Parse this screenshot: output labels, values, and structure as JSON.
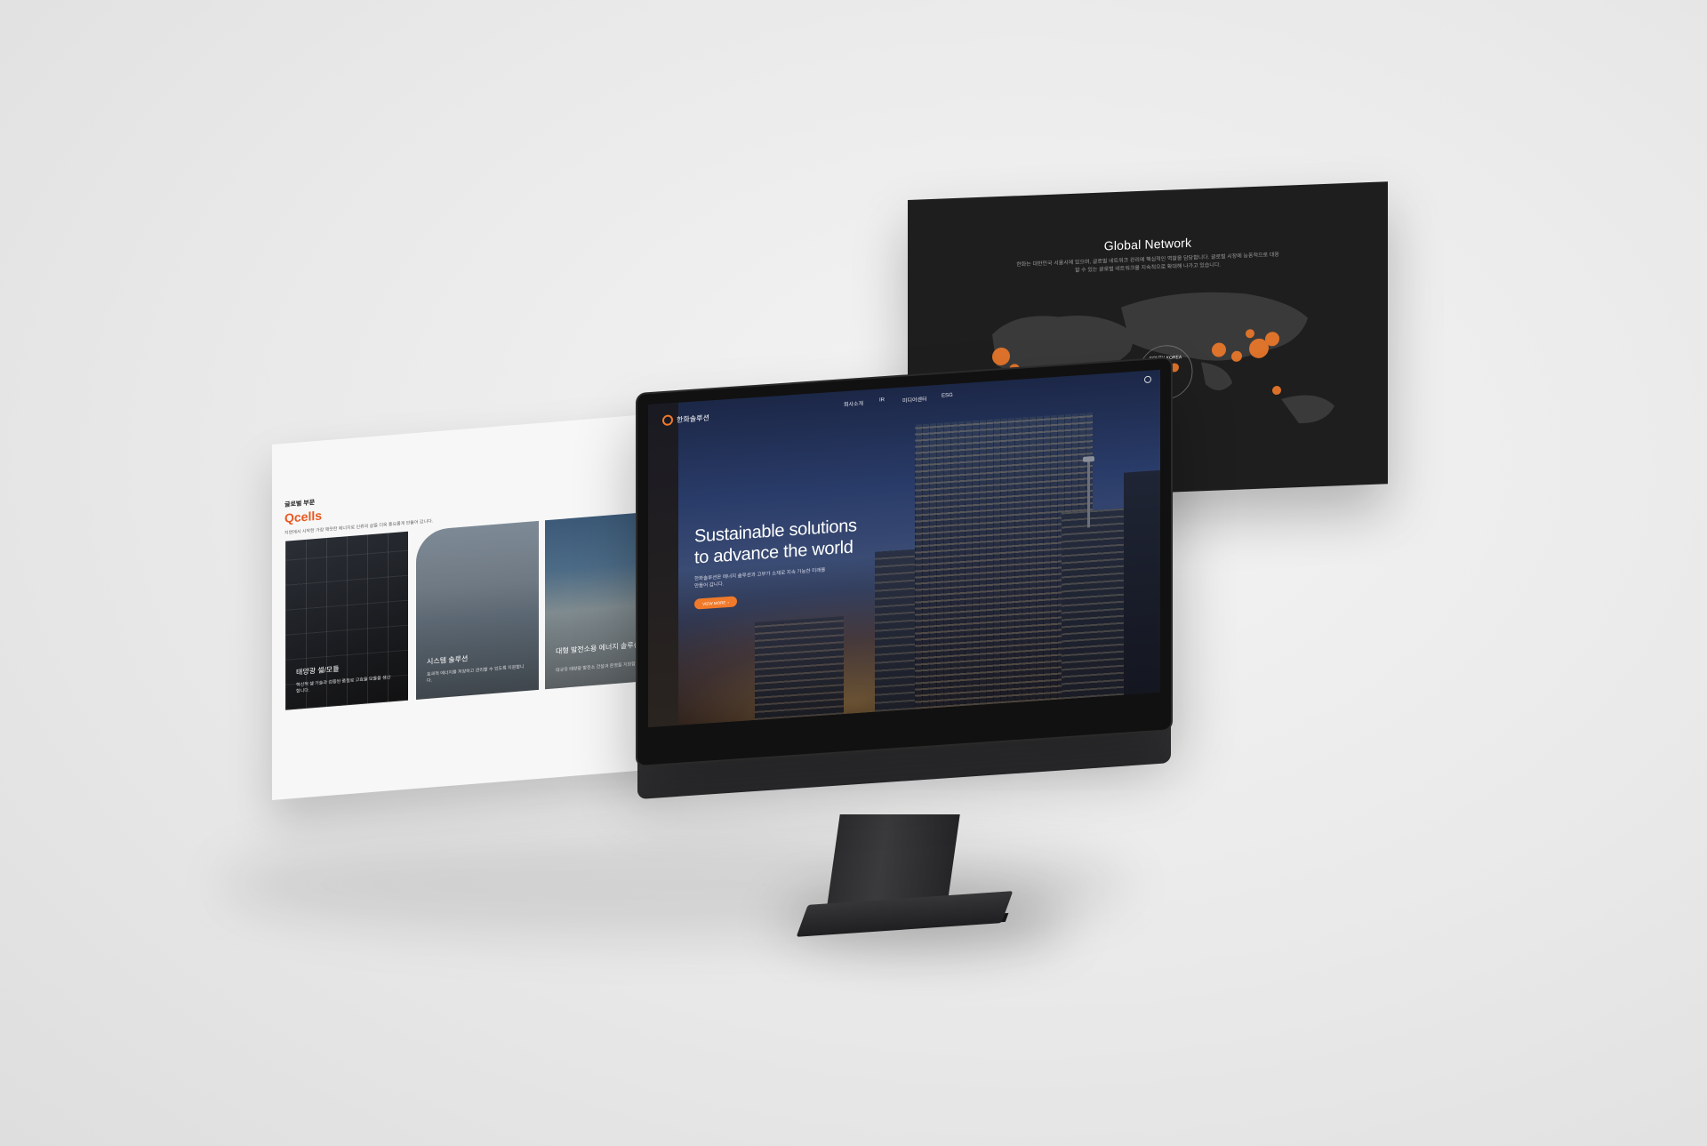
{
  "network_panel": {
    "title": "Global Network",
    "description": "한화는 대한민국 서울시에 있으며, 글로벌 네트워크 관리에 핵심적인 역할을 담당합니다. 글로벌 시장에 능동적으로 대응할 수 있는 글로벌 네트워크를 지속적으로 확대해 나가고 있습니다.",
    "hub_label": "SOUTH KOREA",
    "accent_color": "#f07a2a"
  },
  "qcells_panel": {
    "label": "글로벌 부문",
    "brand": "Qcells",
    "description": "지면에서 시작한 가장 깨끗한 에너지로 인류의 삶을 더욱 풍요롭게 만들어 갑니다.",
    "cards": [
      {
        "title": "태양광 셀/모듈",
        "text": "혁신적 셀 기술과 검증된 품질로 고효율 모듈을 생산합니다."
      },
      {
        "title": "시스템 솔루션",
        "text": "효과적 에너지를 저장하고 관리할 수 있도록 지원합니다."
      },
      {
        "title": "대형 발전소용 에너지 솔루션",
        "text": "대규모 태양광 발전소 건설과 운영을 지원합니다."
      }
    ],
    "brand_color": "#e8581f"
  },
  "monitor_screen": {
    "logo_text": "한화솔루션",
    "nav": [
      "회사소개",
      "IR",
      "미디어센터",
      "ESG"
    ],
    "hero_title": "Sustainable solutions\nto advance the world",
    "hero_desc": "한화솔루션은 에너지 솔루션과 고부가 소재로 지속 가능한 미래를 만들어 갑니다.",
    "hero_button": "VIEW MORE",
    "accent_color": "#f07a2a"
  }
}
